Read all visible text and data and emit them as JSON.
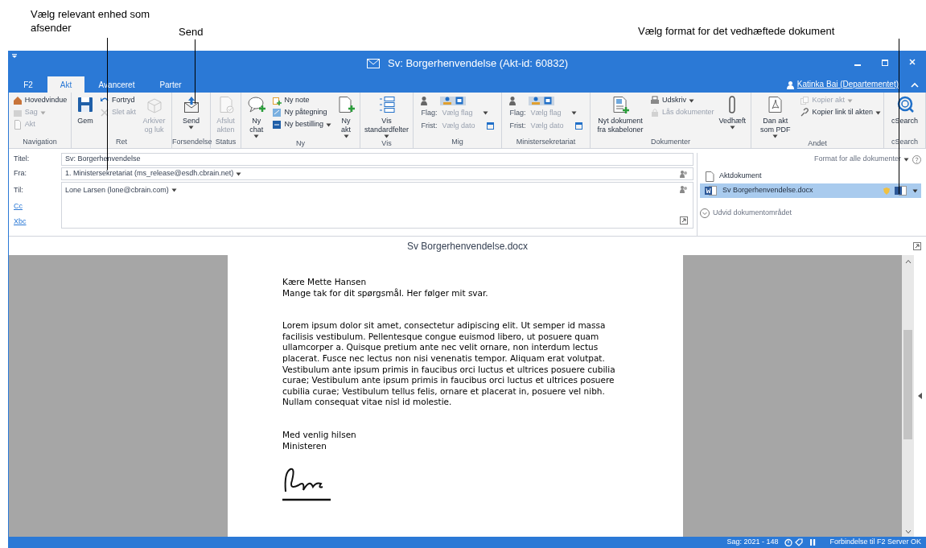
{
  "annotations": [
    {
      "text": "Vælg relevant enhed som afsender"
    },
    {
      "text": "Send"
    },
    {
      "text": "Vælg format for det vedhæftede dokument"
    }
  ],
  "window": {
    "title": "Sv: Borgerhenvendelse (Akt-id: 60832)"
  },
  "tabs": [
    {
      "label": "F2",
      "selected": false
    },
    {
      "label": "Akt",
      "selected": true
    },
    {
      "label": "Avanceret",
      "selected": false
    },
    {
      "label": "Parter",
      "selected": false
    }
  ],
  "user": "Katinka Bai (Departementet)",
  "ribbon": [
    {
      "label": "Navigation",
      "items": [
        {
          "kind": "stack",
          "items": [
            {
              "label": "Hovedvindue",
              "disabled": false,
              "dropdown": false
            },
            {
              "label": "Sag",
              "disabled": true,
              "dropdown": true
            },
            {
              "label": "Akt",
              "disabled": true,
              "dropdown": false
            }
          ]
        }
      ]
    },
    {
      "label": "Ret",
      "items": [
        {
          "kind": "large",
          "label": "Gem",
          "disabled": false,
          "dropdown": false
        },
        {
          "kind": "stack",
          "items": [
            {
              "label": "Fortryd",
              "disabled": false,
              "dropdown": false
            },
            {
              "label": "Slet akt",
              "disabled": true,
              "dropdown": false
            }
          ]
        },
        {
          "kind": "large",
          "label": "Arkiver og luk",
          "disabled": true,
          "dropdown": false
        }
      ]
    },
    {
      "label": "Forsendelse",
      "items": [
        {
          "kind": "large",
          "label": "Send",
          "disabled": false,
          "dropdown": true
        }
      ]
    },
    {
      "label": "Status",
      "items": [
        {
          "kind": "large",
          "label": "Afslut akten",
          "disabled": true,
          "dropdown": false
        }
      ]
    },
    {
      "label": "Ny",
      "items": [
        {
          "kind": "large",
          "label": "Ny chat",
          "disabled": false,
          "dropdown": true
        },
        {
          "kind": "stack",
          "items": [
            {
              "label": "Ny note",
              "disabled": false,
              "dropdown": false
            },
            {
              "label": "Ny påtegning",
              "disabled": false,
              "dropdown": false
            },
            {
              "label": "Ny bestilling",
              "disabled": false,
              "dropdown": true
            }
          ]
        },
        {
          "kind": "large",
          "label": "Ny akt",
          "disabled": false,
          "dropdown": true
        }
      ]
    },
    {
      "label": "Vis",
      "items": [
        {
          "kind": "large",
          "label": "Vis standardfelter",
          "disabled": false,
          "dropdown": true
        }
      ]
    },
    {
      "label": "Mig",
      "items": [
        {
          "kind": "flag",
          "flag_label": "Flag:",
          "flag_value": "Vælg flag",
          "date_label": "Frist:",
          "date_value": "Vælg dato"
        }
      ]
    },
    {
      "label": "Ministersekretariat",
      "items": [
        {
          "kind": "flag",
          "flag_label": "Flag:",
          "flag_value": "Vælg flag",
          "date_label": "Frist:",
          "date_value": "Vælg dato"
        }
      ]
    },
    {
      "label": "Dokumenter",
      "items": [
        {
          "kind": "large",
          "label": "Nyt dokument fra skabeloner",
          "disabled": false,
          "dropdown": false
        },
        {
          "kind": "stack",
          "items": [
            {
              "label": "Udskriv",
              "disabled": false,
              "dropdown": true
            },
            {
              "label": "Lås dokumenter",
              "disabled": true,
              "dropdown": false
            }
          ]
        },
        {
          "kind": "large",
          "label": "Vedhæft",
          "disabled": false,
          "dropdown": true
        }
      ]
    },
    {
      "label": "Andet",
      "items": [
        {
          "kind": "large",
          "label": "Dan akt som PDF",
          "disabled": false,
          "dropdown": true
        },
        {
          "kind": "stack",
          "items": [
            {
              "label": "Kopier akt",
              "disabled": true,
              "dropdown": true
            },
            {
              "label": "Kopier link til akten",
              "disabled": false,
              "dropdown": true
            }
          ]
        }
      ]
    },
    {
      "label": "cSearch",
      "items": [
        {
          "kind": "large",
          "label": "cSearch",
          "disabled": false,
          "dropdown": false
        }
      ]
    }
  ],
  "form": {
    "fields": [
      {
        "kind": "text",
        "label": "Titel:",
        "value": "Sv: Borgerhenvendelse",
        "dropdown": false
      },
      {
        "kind": "text",
        "label": "Fra:",
        "value": "1. Ministersekretariat (ms_release@esdh.cbrain.net)",
        "dropdown": true
      },
      {
        "kind": "recipients",
        "label": "Til:",
        "value": "Lone Larsen (lone@cbrain.com)",
        "dropdown": true,
        "links": [
          "Cc",
          "Xbc"
        ]
      }
    ]
  },
  "documents": {
    "format_label": "Format for alle dokumenter",
    "items": [
      {
        "name": "Aktdokument",
        "kind": "blank",
        "selected": false
      },
      {
        "name": "Sv Borgerhenvendelse.docx",
        "kind": "word",
        "selected": true
      }
    ],
    "expand_label": "Udvid dokumentområdet"
  },
  "document": {
    "title": "Sv Borgerhenvendelse.docx",
    "greeting": [
      "Kære Mette Hansen",
      "Mange tak for dit spørgsmål. Her følger mit svar."
    ],
    "body": "Lorem ipsum dolor sit amet, consectetur adipiscing elit. Ut semper id massa facilisis vestibulum. Pellentesque congue euismod libero, ut posuere quam ullamcorper a. Quisque pretium ante nec velit ornare, non interdum lectus placerat. Fusce nec lectus non nisi venenatis tempor. Aliquam erat volutpat. Vestibulum ante ipsum primis in faucibus orci luctus et ultrices posuere cubilia curae; Vestibulum ante ipsum primis in faucibus orci luctus et ultrices posuere cubilia curae; Vestibulum tellus felis, ornare et placerat in, posuere vel nibh. Nullam consequat vitae nisl id molestie.",
    "closing": [
      "Med venlig hilsen",
      "Ministeren"
    ]
  },
  "status_bar": {
    "case": "Sag: 2021 - 148",
    "connection": "Forbindelse til F2 Server OK"
  }
}
